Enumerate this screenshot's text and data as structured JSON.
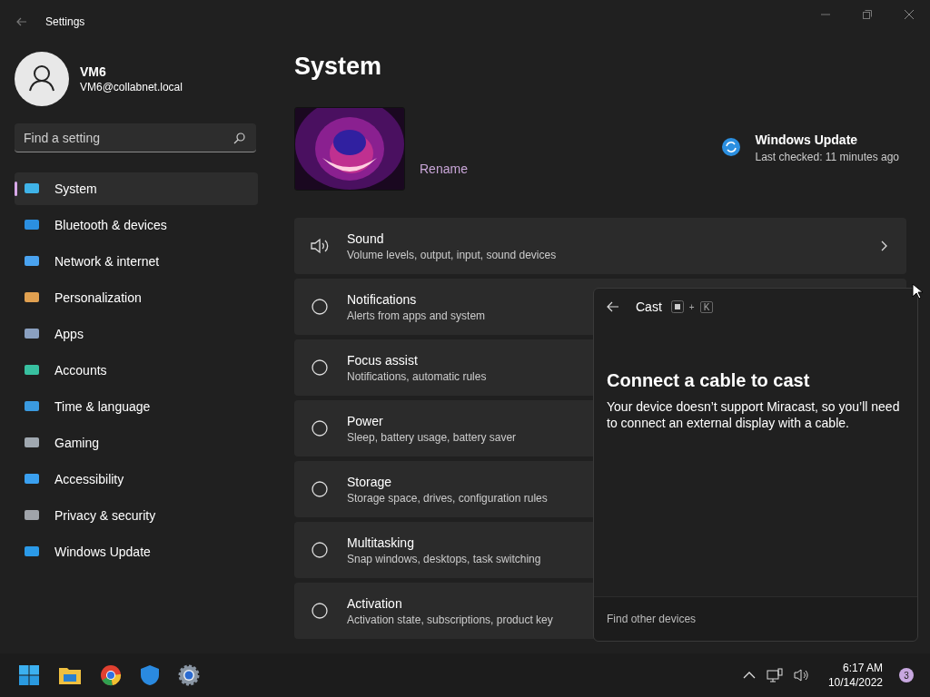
{
  "window": {
    "title": "Settings"
  },
  "user": {
    "name": "VM6",
    "email": "VM6@collabnet.local"
  },
  "search": {
    "placeholder": "Find a setting"
  },
  "sidebar": {
    "items": [
      {
        "label": "System",
        "selected": true
      },
      {
        "label": "Bluetooth & devices",
        "selected": false
      },
      {
        "label": "Network & internet",
        "selected": false
      },
      {
        "label": "Personalization",
        "selected": false
      },
      {
        "label": "Apps",
        "selected": false
      },
      {
        "label": "Accounts",
        "selected": false
      },
      {
        "label": "Time & language",
        "selected": false
      },
      {
        "label": "Gaming",
        "selected": false
      },
      {
        "label": "Accessibility",
        "selected": false
      },
      {
        "label": "Privacy & security",
        "selected": false
      },
      {
        "label": "Windows Update",
        "selected": false
      }
    ]
  },
  "page": {
    "title": "System",
    "rename": "Rename",
    "update": {
      "title": "Windows Update",
      "subtitle": "Last checked: 11 minutes ago"
    }
  },
  "cards": [
    {
      "title": "Sound",
      "subtitle": "Volume levels, output, input, sound devices"
    },
    {
      "title": "Notifications",
      "subtitle": "Alerts from apps and system"
    },
    {
      "title": "Focus assist",
      "subtitle": "Notifications, automatic rules"
    },
    {
      "title": "Power",
      "subtitle": "Sleep, battery usage, battery saver"
    },
    {
      "title": "Storage",
      "subtitle": "Storage space, drives, configuration rules"
    },
    {
      "title": "Multitasking",
      "subtitle": "Snap windows, desktops, task switching"
    },
    {
      "title": "Activation",
      "subtitle": "Activation state, subscriptions, product key"
    }
  ],
  "cast": {
    "title": "Cast",
    "shortcut_plus": "+",
    "shortcut_key": "K",
    "heading": "Connect a cable to cast",
    "body": "Your device doesn’t support Miracast, so you’ll need to connect an external display with a cable.",
    "footer": "Find other devices"
  },
  "taskbar": {
    "time": "6:17 AM",
    "date": "10/14/2022",
    "notifications": "3"
  }
}
